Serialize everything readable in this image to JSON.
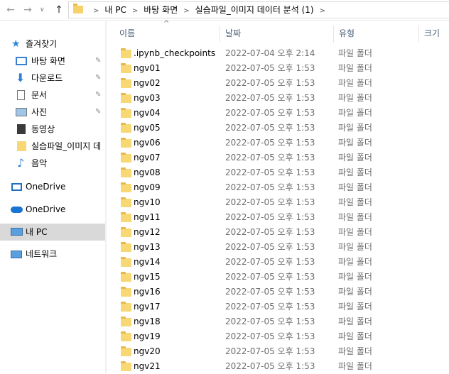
{
  "address": {
    "crumbs": [
      "내 PC",
      "바탕 화면",
      "실습파일_이미지 데이터 분석 (1)"
    ]
  },
  "sidebar": {
    "quick_access": "즐겨찾기",
    "items": [
      {
        "label": "바탕 화면",
        "icon": "desktop-icon",
        "pinned": true
      },
      {
        "label": "다운로드",
        "icon": "download-icon",
        "pinned": true
      },
      {
        "label": "문서",
        "icon": "document-icon",
        "pinned": true
      },
      {
        "label": "사진",
        "icon": "pictures-icon",
        "pinned": true
      },
      {
        "label": "동영상",
        "icon": "video-icon",
        "pinned": false
      },
      {
        "label": "실습파일_이미지 데",
        "icon": "folder-icon",
        "pinned": false
      },
      {
        "label": "음악",
        "icon": "music-icon",
        "pinned": false
      }
    ],
    "onedrive1": "OneDrive",
    "onedrive2": "OneDrive",
    "this_pc": "내 PC",
    "network": "네트워크"
  },
  "columns": {
    "name": "이름",
    "date": "날짜",
    "type": "유형",
    "size": "크기"
  },
  "files": [
    {
      "name": ".ipynb_checkpoints",
      "date": "2022-07-04 오후 2:14",
      "type": "파일 폴더"
    },
    {
      "name": "ngv01",
      "date": "2022-07-05 오후 1:53",
      "type": "파일 폴더"
    },
    {
      "name": "ngv02",
      "date": "2022-07-05 오후 1:53",
      "type": "파일 폴더"
    },
    {
      "name": "ngv03",
      "date": "2022-07-05 오후 1:53",
      "type": "파일 폴더"
    },
    {
      "name": "ngv04",
      "date": "2022-07-05 오후 1:53",
      "type": "파일 폴더"
    },
    {
      "name": "ngv05",
      "date": "2022-07-05 오후 1:53",
      "type": "파일 폴더"
    },
    {
      "name": "ngv06",
      "date": "2022-07-05 오후 1:53",
      "type": "파일 폴더"
    },
    {
      "name": "ngv07",
      "date": "2022-07-05 오후 1:53",
      "type": "파일 폴더"
    },
    {
      "name": "ngv08",
      "date": "2022-07-05 오후 1:53",
      "type": "파일 폴더"
    },
    {
      "name": "ngv09",
      "date": "2022-07-05 오후 1:53",
      "type": "파일 폴더"
    },
    {
      "name": "ngv10",
      "date": "2022-07-05 오후 1:53",
      "type": "파일 폴더"
    },
    {
      "name": "ngv11",
      "date": "2022-07-05 오후 1:53",
      "type": "파일 폴더"
    },
    {
      "name": "ngv12",
      "date": "2022-07-05 오후 1:53",
      "type": "파일 폴더"
    },
    {
      "name": "ngv13",
      "date": "2022-07-05 오후 1:53",
      "type": "파일 폴더"
    },
    {
      "name": "ngv14",
      "date": "2022-07-05 오후 1:53",
      "type": "파일 폴더"
    },
    {
      "name": "ngv15",
      "date": "2022-07-05 오후 1:53",
      "type": "파일 폴더"
    },
    {
      "name": "ngv16",
      "date": "2022-07-05 오후 1:53",
      "type": "파일 폴더"
    },
    {
      "name": "ngv17",
      "date": "2022-07-05 오후 1:53",
      "type": "파일 폴더"
    },
    {
      "name": "ngv18",
      "date": "2022-07-05 오후 1:53",
      "type": "파일 폴더"
    },
    {
      "name": "ngv19",
      "date": "2022-07-05 오후 1:53",
      "type": "파일 폴더"
    },
    {
      "name": "ngv20",
      "date": "2022-07-05 오후 1:53",
      "type": "파일 폴더"
    },
    {
      "name": "ngv21",
      "date": "2022-07-05 오후 1:53",
      "type": "파일 폴더"
    }
  ]
}
